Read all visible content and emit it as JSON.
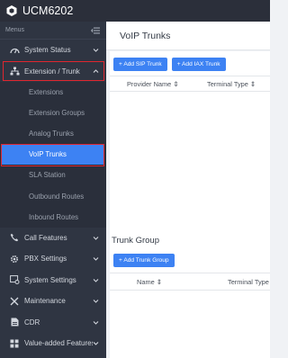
{
  "app": {
    "title": "UCM6202"
  },
  "sidebar": {
    "menus_label": "Menus",
    "top_items": [
      {
        "label": "System Status"
      },
      {
        "label": "Extension / Trunk"
      }
    ],
    "sub_items": [
      {
        "label": "Extensions"
      },
      {
        "label": "Extension Groups"
      },
      {
        "label": "Analog Trunks"
      },
      {
        "label": "VoIP Trunks",
        "active": true
      },
      {
        "label": "SLA Station"
      },
      {
        "label": "Outbound Routes"
      },
      {
        "label": "Inbound Routes"
      }
    ],
    "bottom_items": [
      {
        "label": "Call Features"
      },
      {
        "label": "PBX Settings"
      },
      {
        "label": "System Settings"
      },
      {
        "label": "Maintenance"
      },
      {
        "label": "CDR"
      },
      {
        "label": "Value-added Features"
      }
    ]
  },
  "main": {
    "page_title": "VoIP Trunks",
    "buttons": {
      "add_sip": "+ Add SIP Trunk",
      "add_iax": "+ Add IAX Trunk"
    },
    "trunks_table": {
      "columns": [
        "Provider Name ⇕",
        "Terminal Type ⇕"
      ]
    },
    "trunk_group": {
      "title": "Trunk Group",
      "add_button": "+ Add Trunk Group",
      "columns": [
        "Name ⇕",
        "Terminal Type"
      ]
    }
  },
  "colors": {
    "accent": "#3d82f3",
    "sidebar_bg": "#2f3542",
    "topbar_bg": "#2b2f3a",
    "highlight": "#e0262f"
  }
}
